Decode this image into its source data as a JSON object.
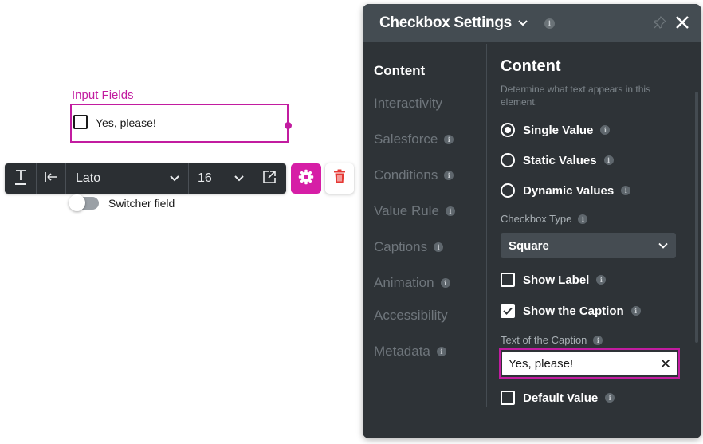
{
  "canvas": {
    "section_label": "Input Fields",
    "checkbox_caption": "Yes, please!",
    "switcher_label": "Switcher field"
  },
  "toolbar": {
    "text_style_icon": "text-underline-icon",
    "align_icon": "align-left-bar-icon",
    "font_family": "Lato",
    "font_size": "16",
    "external_icon": "open-external-icon",
    "settings_icon": "gear-icon",
    "delete_icon": "trash-icon"
  },
  "panel": {
    "title": "Checkbox Settings",
    "nav": [
      {
        "label": "Content",
        "active": true,
        "info": false
      },
      {
        "label": "Interactivity",
        "active": false,
        "info": false
      },
      {
        "label": "Salesforce",
        "active": false,
        "info": true
      },
      {
        "label": "Conditions",
        "active": false,
        "info": true
      },
      {
        "label": "Value Rule",
        "active": false,
        "info": true
      },
      {
        "label": "Captions",
        "active": false,
        "info": true
      },
      {
        "label": "Animation",
        "active": false,
        "info": true
      },
      {
        "label": "Accessibility",
        "active": false,
        "info": false
      },
      {
        "label": "Metadata",
        "active": false,
        "info": true
      }
    ],
    "content": {
      "heading": "Content",
      "description": "Determine what text appears in this element.",
      "value_modes": [
        {
          "label": "Single Value",
          "checked": true
        },
        {
          "label": "Static Values",
          "checked": false
        },
        {
          "label": "Dynamic Values",
          "checked": false
        }
      ],
      "checkbox_type_label": "Checkbox Type",
      "checkbox_type_value": "Square",
      "show_label": {
        "label": "Show Label",
        "checked": false
      },
      "show_caption": {
        "label": "Show the Caption",
        "checked": true
      },
      "caption_text_label": "Text of the Caption",
      "caption_text_value": "Yes, please!",
      "default_value": {
        "label": "Default Value",
        "checked": false
      }
    }
  },
  "colors": {
    "accent": "#c21ca0",
    "gear_button": "#d61ea6",
    "panel_bg": "#2e3337",
    "panel_header": "#444c52",
    "trash_red": "#e53935"
  }
}
